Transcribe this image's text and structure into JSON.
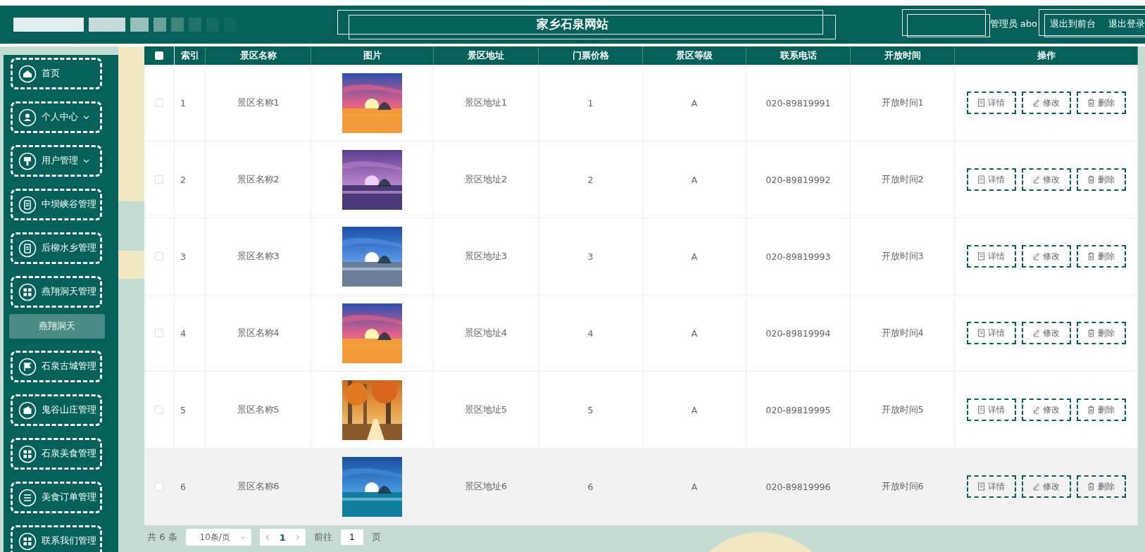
{
  "header": {
    "title": "家乡石泉网站",
    "user": "管理员 abo",
    "links": [
      "退出到前台",
      "退出登录"
    ]
  },
  "sidebar": {
    "items": [
      {
        "label": "首页"
      },
      {
        "label": "个人中心",
        "expanded": false
      },
      {
        "label": "用户管理",
        "expanded": false
      },
      {
        "label": "中坝峡谷管理"
      },
      {
        "label": "后柳水乡管理"
      },
      {
        "label": "燕翔洞天管理",
        "expanded": true,
        "children": [
          {
            "label": "燕翔洞天",
            "selected": true
          }
        ]
      },
      {
        "label": "石泉古城管理"
      },
      {
        "label": "鬼谷山庄管理"
      },
      {
        "label": "石泉美食管理"
      },
      {
        "label": "美食订单管理"
      },
      {
        "label": "联系我们管理"
      }
    ]
  },
  "table": {
    "select_all": {
      "checked": false
    },
    "columns": [
      "索引",
      "景区名称",
      "图片",
      "景区地址",
      "门票价格",
      "景区等级",
      "联系电话",
      "开放时间",
      "操作"
    ],
    "rows": [
      {
        "checked": false,
        "highlighted": false,
        "index": "1",
        "name": "景区名称1",
        "address": "景区地址1",
        "price": "1",
        "level": "A",
        "phone": "020-89819991",
        "hours": "开放时间1",
        "actions": [
          "详情",
          "修改",
          "删除"
        ]
      },
      {
        "checked": false,
        "highlighted": false,
        "index": "2",
        "name": "景区名称2",
        "address": "景区地址2",
        "price": "2",
        "level": "A",
        "phone": "020-89819992",
        "hours": "开放时间2",
        "actions": [
          "详情",
          "修改",
          "删除"
        ]
      },
      {
        "checked": false,
        "highlighted": false,
        "index": "3",
        "name": "景区名称3",
        "address": "景区地址3",
        "price": "3",
        "level": "A",
        "phone": "020-89819993",
        "hours": "开放时间3",
        "actions": [
          "详情",
          "修改",
          "删除"
        ]
      },
      {
        "checked": false,
        "highlighted": false,
        "index": "4",
        "name": "景区名称4",
        "address": "景区地址4",
        "price": "4",
        "level": "A",
        "phone": "020-89819994",
        "hours": "开放时间4",
        "actions": [
          "详情",
          "修改",
          "删除"
        ]
      },
      {
        "checked": false,
        "highlighted": false,
        "index": "5",
        "name": "景区名称5",
        "address": "景区地址5",
        "price": "5",
        "level": "A",
        "phone": "020-89819995",
        "hours": "开放时间5",
        "actions": [
          "详情",
          "修改",
          "删除"
        ]
      },
      {
        "checked": false,
        "highlighted": true,
        "index": "6",
        "name": "景区名称6",
        "address": "景区地址6",
        "price": "6",
        "level": "A",
        "phone": "020-89819996",
        "hours": "开放时间6",
        "actions": [
          "详情",
          "修改",
          "删除"
        ]
      }
    ]
  },
  "pagination": {
    "total": "共 6 条",
    "page_size": "10条/页",
    "prev": "‹",
    "current_page": "1",
    "next": "›",
    "goto_label": "前往",
    "goto_value": "1",
    "goto_unit": "页"
  }
}
